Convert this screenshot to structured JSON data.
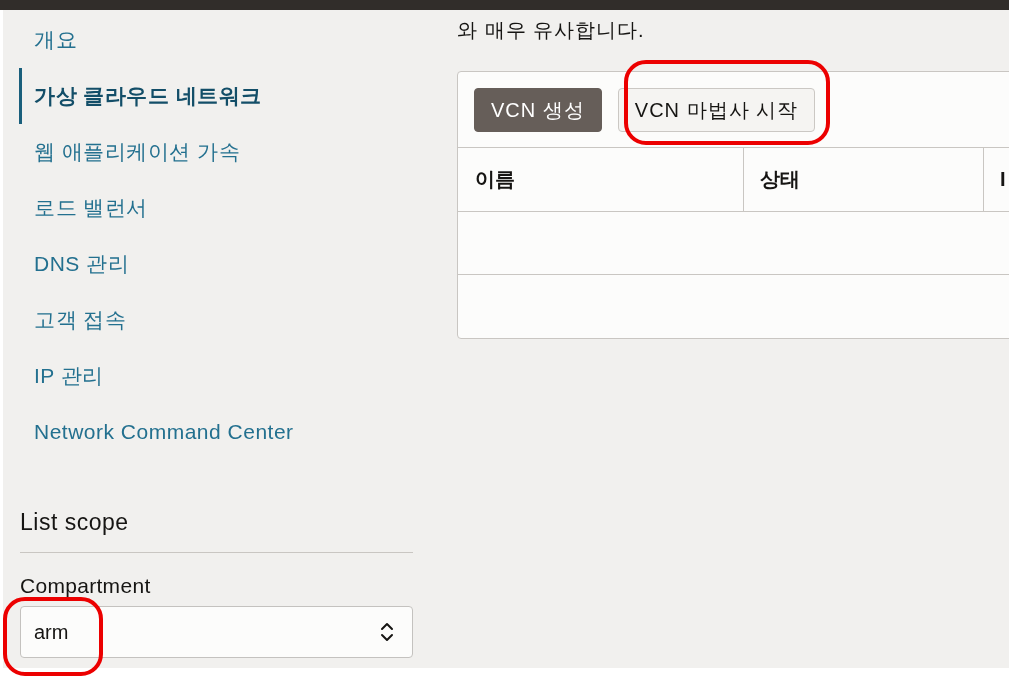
{
  "sidebar": {
    "items": [
      {
        "label": "개요",
        "selected": false
      },
      {
        "label": "가상 클라우드 네트워크",
        "selected": true
      },
      {
        "label": "웹 애플리케이션 가속",
        "selected": false
      },
      {
        "label": "로드 밸런서",
        "selected": false
      },
      {
        "label": "DNS 관리",
        "selected": false
      },
      {
        "label": "고객 접속",
        "selected": false
      },
      {
        "label": "IP 관리",
        "selected": false
      },
      {
        "label": "Network Command Center",
        "selected": false
      }
    ]
  },
  "list_scope": {
    "title": "List scope",
    "compartment": {
      "label": "Compartment",
      "value": "arm",
      "highlighted": true
    }
  },
  "intro_text": "와 매우 유사합니다.",
  "panel": {
    "buttons": [
      {
        "label": "VCN 생성",
        "kind": "primary",
        "highlighted": false
      },
      {
        "label": "VCN 마법사 시작",
        "kind": "secondary",
        "highlighted": true
      }
    ],
    "table": {
      "columns": [
        "이름",
        "상태",
        "I"
      ]
    }
  }
}
